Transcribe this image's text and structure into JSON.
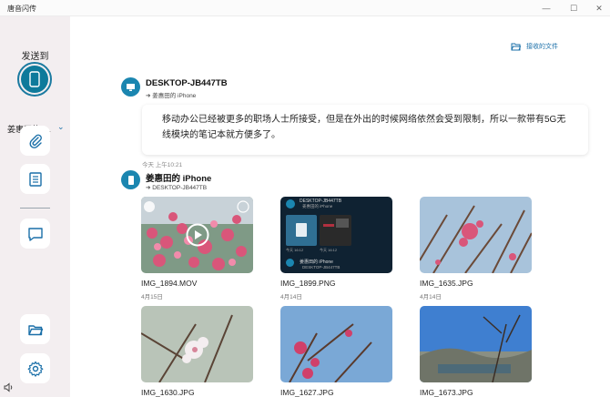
{
  "window": {
    "title": "唐音闪传",
    "minimize": "—",
    "maximize": "☐",
    "close": "✕"
  },
  "sidebar": {
    "send_to_label": "发送到",
    "device_name": "姜惠田的 i...",
    "device_icon": "phone-icon",
    "buttons": [
      "paperclip-icon",
      "document-icon",
      "message-icon",
      "folder-icon",
      "settings-icon"
    ],
    "sound_icon": "speaker-icon"
  },
  "header": {
    "received_files_label": "接收的文件",
    "received_icon": "folder-open-icon"
  },
  "messages": [
    {
      "sender": "DESKTOP-JB447TB",
      "recipient": "➔ 姜惠田的 iPhone",
      "icon": "monitor-icon",
      "text": "移动办公已经被更多的职场人士所接受，但是在外出的时候网络依然会受到限制，所以一款带有5G无线模块的笔记本就方便多了。",
      "time": "今天 上午10:21"
    },
    {
      "sender": "姜惠田的 iPhone",
      "recipient": "➔ DESKTOP-JB447TB",
      "icon": "phone-icon"
    }
  ],
  "files": [
    {
      "name": "IMG_1894.MOV",
      "date": "4月15日",
      "type": "video"
    },
    {
      "name": "IMG_1899.PNG",
      "date": "4月14日",
      "type": "screenshot"
    },
    {
      "name": "IMG_1635.JPG",
      "date": "4月14日",
      "type": "photo"
    },
    {
      "name": "IMG_1630.JPG",
      "date": "",
      "type": "photo"
    },
    {
      "name": "IMG_1627.JPG",
      "date": "",
      "type": "photo"
    },
    {
      "name": "IMG_1673.JPG",
      "date": "",
      "type": "photo"
    }
  ],
  "screenshot_preview": {
    "top_sender": "DESKTOP-JB447TB",
    "top_recipient": "姜惠田的 iPhone",
    "bottom_sender": "姜惠田的 iPhone",
    "bottom_recipient": "DESKTOP-JB447TB",
    "time_left": "今天 16:12",
    "time_right": "今天 16:12"
  },
  "colors": {
    "accent": "#1a6fa8",
    "sidebar_bg": "#f3eef0",
    "avatar": "#1b86b0"
  }
}
